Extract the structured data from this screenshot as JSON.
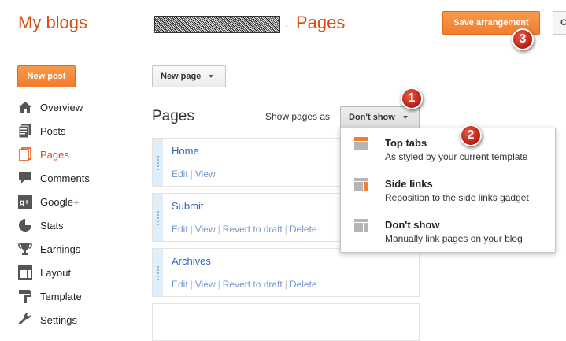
{
  "header": {
    "app_title": "My blogs",
    "separator": "·",
    "section_title": "Pages",
    "save_label": "Save arrangement",
    "cancel_label": "C"
  },
  "sidebar": {
    "new_post_label": "New post",
    "items": [
      {
        "label": "Overview",
        "icon": "home-icon"
      },
      {
        "label": "Posts",
        "icon": "posts-icon"
      },
      {
        "label": "Pages",
        "icon": "pages-icon",
        "active": true
      },
      {
        "label": "Comments",
        "icon": "comments-icon"
      },
      {
        "label": "Google+",
        "icon": "google-plus-icon"
      },
      {
        "label": "Stats",
        "icon": "stats-icon"
      },
      {
        "label": "Earnings",
        "icon": "trophy-icon"
      },
      {
        "label": "Layout",
        "icon": "layout-icon"
      },
      {
        "label": "Template",
        "icon": "template-icon"
      },
      {
        "label": "Settings",
        "icon": "wrench-icon"
      }
    ]
  },
  "main": {
    "new_page_label": "New page",
    "heading": "Pages",
    "show_pages_label": "Show pages as",
    "dropdown_value": "Don't show",
    "pages": [
      {
        "name": "Home",
        "actions": [
          "Edit",
          "View"
        ]
      },
      {
        "name": "Submit",
        "actions": [
          "Edit",
          "View",
          "Revert to draft",
          "Delete"
        ]
      },
      {
        "name": "Archives",
        "actions": [
          "Edit",
          "View",
          "Revert to draft",
          "Delete"
        ]
      }
    ]
  },
  "menu": {
    "options": [
      {
        "title": "Top tabs",
        "description": "As styled by your current template",
        "icon": "top-tabs-icon"
      },
      {
        "title": "Side links",
        "description": "Reposition to the side links gadget",
        "icon": "side-links-icon"
      },
      {
        "title": "Don't show",
        "description": "Manually link pages on your blog",
        "icon": "no-show-icon"
      }
    ]
  },
  "badges": [
    "1",
    "2",
    "3"
  ],
  "colors": {
    "accent": "#dd4b0e",
    "button_orange": "#f47c2f",
    "link": "#2a66b6",
    "badge_red": "#c8291a"
  }
}
